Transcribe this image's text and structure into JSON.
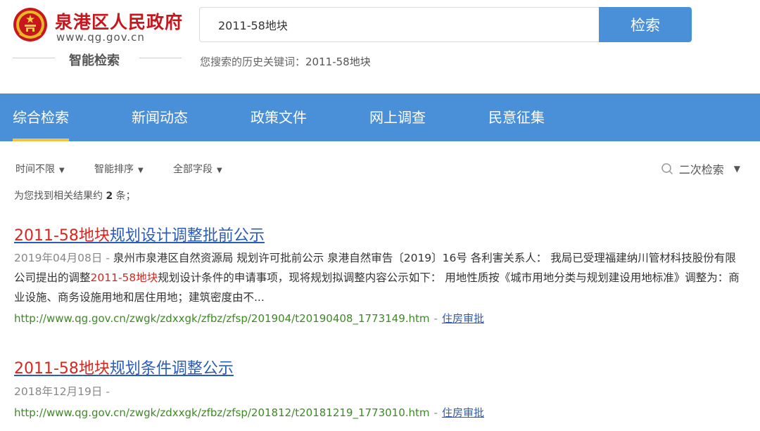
{
  "site": {
    "name": "泉港区人民政府",
    "domain": "www.qg.gov.cn",
    "search_subtitle": "智能检索",
    "emblem_icon": "national-emblem-icon",
    "brand_color": "#c8161d"
  },
  "search": {
    "query": "2011-58地块",
    "button_label": "检索",
    "history_label": "您搜索的历史关键词：",
    "history_keyword": "2011-58地块",
    "accent_color": "#4a90d9"
  },
  "nav": {
    "tabs": [
      {
        "label": "综合检索",
        "active": true
      },
      {
        "label": "新闻动态",
        "active": false
      },
      {
        "label": "政策文件",
        "active": false
      },
      {
        "label": "网上调查",
        "active": false
      },
      {
        "label": "民意征集",
        "active": false
      }
    ]
  },
  "filters": {
    "time": "时间不限",
    "sort": "智能排序",
    "field": "全部字段",
    "secondary_search": "二次检索"
  },
  "result_count": {
    "prefix": "为您找到相关结果约",
    "count": "2",
    "suffix": "条；"
  },
  "results": [
    {
      "title_highlight": "2011-58地块",
      "title_rest": "规划设计调整批前公示",
      "date": "2019年04月08日",
      "date_sep": " - ",
      "snippet_before": "泉州市泉港区自然资源局 规划许可批前公示 泉港自然审告〔2019〕16号 各利害关系人：  我局已受理福建纳川管材科技股份有限公司提出的调整",
      "snippet_highlight": "2011-58地块",
      "snippet_after": "规划设计条件的申请事项，现将规划拟调整内容公示如下：  用地性质按《城市用地分类与规划建设用地标准》调整为：商业设施、商务设施用地和居住用地；建筑密度由不...",
      "url": "http://www.qg.gov.cn/zwgk/zdxxgk/zfbz/zfsp/201904/t20190408_1773149.htm",
      "url_sep": "-",
      "category": "住房审批"
    },
    {
      "title_highlight": "2011-58地块",
      "title_rest": "规划条件调整公示",
      "date": "2018年12月19日",
      "date_sep": " -",
      "url": "http://www.qg.gov.cn/zwgk/zdxxgk/zfbz/zfsp/201812/t20181219_1773010.htm",
      "url_sep": "-",
      "category": "住房审批"
    }
  ]
}
